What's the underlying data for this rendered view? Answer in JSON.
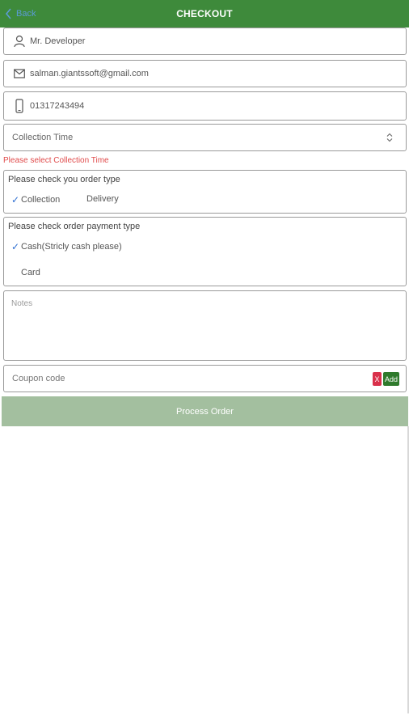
{
  "header": {
    "back_label": "Back",
    "title": "CHECKOUT",
    "bar_color": "#3e8a3b"
  },
  "form": {
    "name_value": "Mr. Developer",
    "email_value": "salman.giantssoft@gmail.com",
    "phone_value": "01317243494",
    "collection_time_placeholder": "Collection Time",
    "collection_time_error": "Please select Collection Time",
    "order_type": {
      "label": "Please check you order type",
      "options": [
        "Collection",
        "Delivery"
      ],
      "selected": "Collection"
    },
    "payment_type": {
      "label": "Please check order payment type",
      "options": [
        "Cash(Stricly cash please)",
        "Card"
      ],
      "selected": "Cash(Stricly cash please)"
    },
    "notes_placeholder": "Notes",
    "coupon_placeholder": "Coupon code",
    "coupon_clear_label": "X",
    "coupon_add_label": "Add",
    "process_label": "Process Order"
  },
  "icons": {
    "back": "chevron-left-icon",
    "name": "user-icon",
    "email": "envelope-icon",
    "phone": "phone-icon",
    "dropdown": "updown-chevron-icon",
    "check": "checkmark-icon"
  }
}
